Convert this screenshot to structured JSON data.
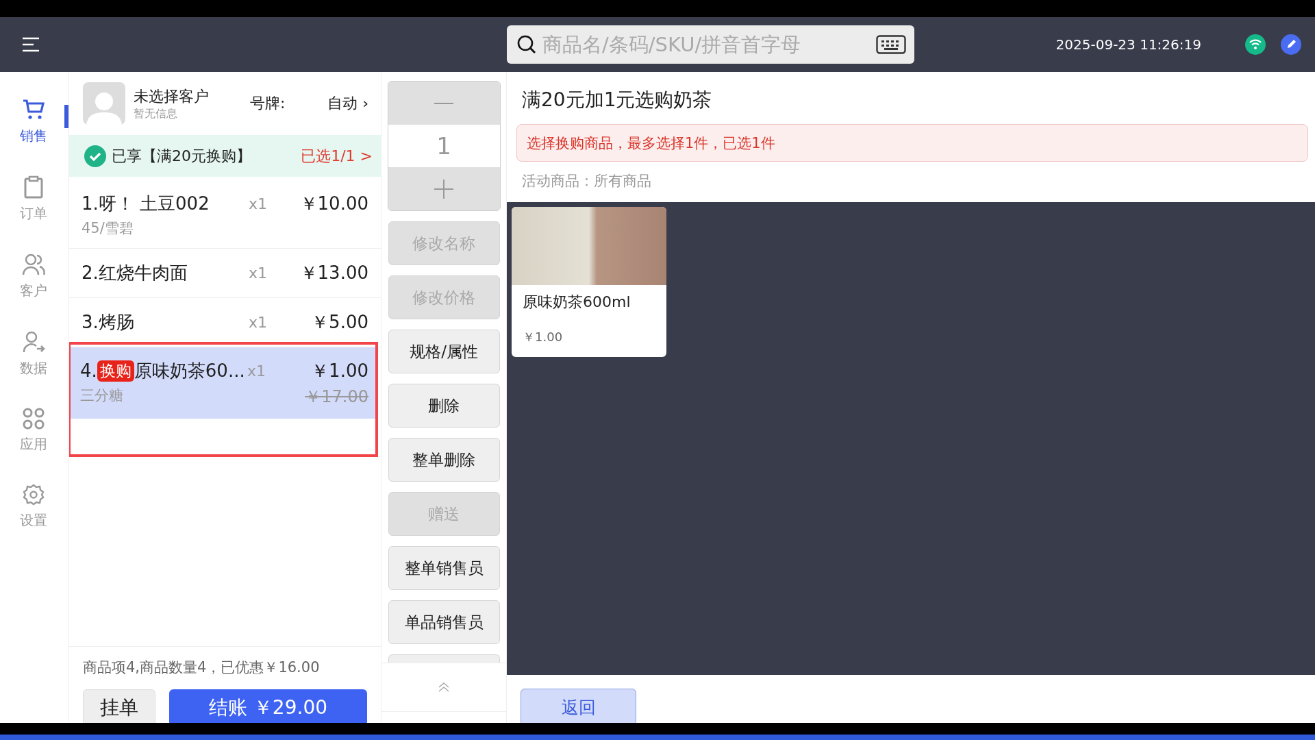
{
  "header": {
    "search": {
      "placeholder": "商品名/条码/SKU/拼音首字母"
    },
    "datetime": "2025-09-23 11:26:19"
  },
  "nav": [
    {
      "kind": "cart",
      "label": "销售",
      "selected": true
    },
    {
      "kind": "clipboard",
      "label": "订单",
      "selected": false
    },
    {
      "kind": "users",
      "label": "客户",
      "selected": false
    },
    {
      "kind": "user-arrow",
      "label": "数据",
      "selected": false
    },
    {
      "kind": "apps",
      "label": "应用",
      "selected": false
    },
    {
      "kind": "gear",
      "label": "设置",
      "selected": false
    }
  ],
  "customer": {
    "name": "未选择客户",
    "info": "暂无信息",
    "plate_label": "号牌:",
    "plate_value": "自动 ›"
  },
  "promo": {
    "text": "已享【满20元换购】",
    "status": "已选1/1 >"
  },
  "items": [
    {
      "name": "1.呀！ 土豆002",
      "spec": "45/雪碧",
      "qty": "x1",
      "price": "￥10.00",
      "selected": false
    },
    {
      "name": "2.红烧牛肉面",
      "qty": "x1",
      "price": "￥13.00",
      "selected": false
    },
    {
      "name": "3.烤肠",
      "qty": "x1",
      "price": "￥5.00",
      "selected": false
    },
    {
      "name": "4.",
      "tag": "换购",
      "name_after": "原味奶茶60...",
      "spec": "三分糖",
      "qty": "x1",
      "price": "￥1.00",
      "original_price": "￥17.00",
      "selected": true
    }
  ],
  "summary": "商品项4,商品数量4，已优惠￥16.00",
  "hold_button": "挂单",
  "checkout_button": "结账 ￥29.00",
  "quantity": "1",
  "actions": [
    {
      "label": "修改名称",
      "disabled": true
    },
    {
      "label": "修改价格",
      "disabled": true
    },
    {
      "label": "规格/属性",
      "disabled": false
    },
    {
      "label": "删除",
      "disabled": false
    },
    {
      "label": "整单删除",
      "disabled": false
    },
    {
      "label": "赠送",
      "disabled": true
    },
    {
      "label": "整单销售员",
      "disabled": false
    },
    {
      "label": "单品销售员",
      "disabled": false
    }
  ],
  "panel": {
    "title": "满20元加1元选购奶茶",
    "alert": "选择换购商品，最多选择1件，已选1件",
    "scope": "活动商品：所有商品",
    "products": [
      {
        "name": "原味奶茶600ml",
        "price": "￥1.00"
      }
    ],
    "back_button": "返回"
  }
}
